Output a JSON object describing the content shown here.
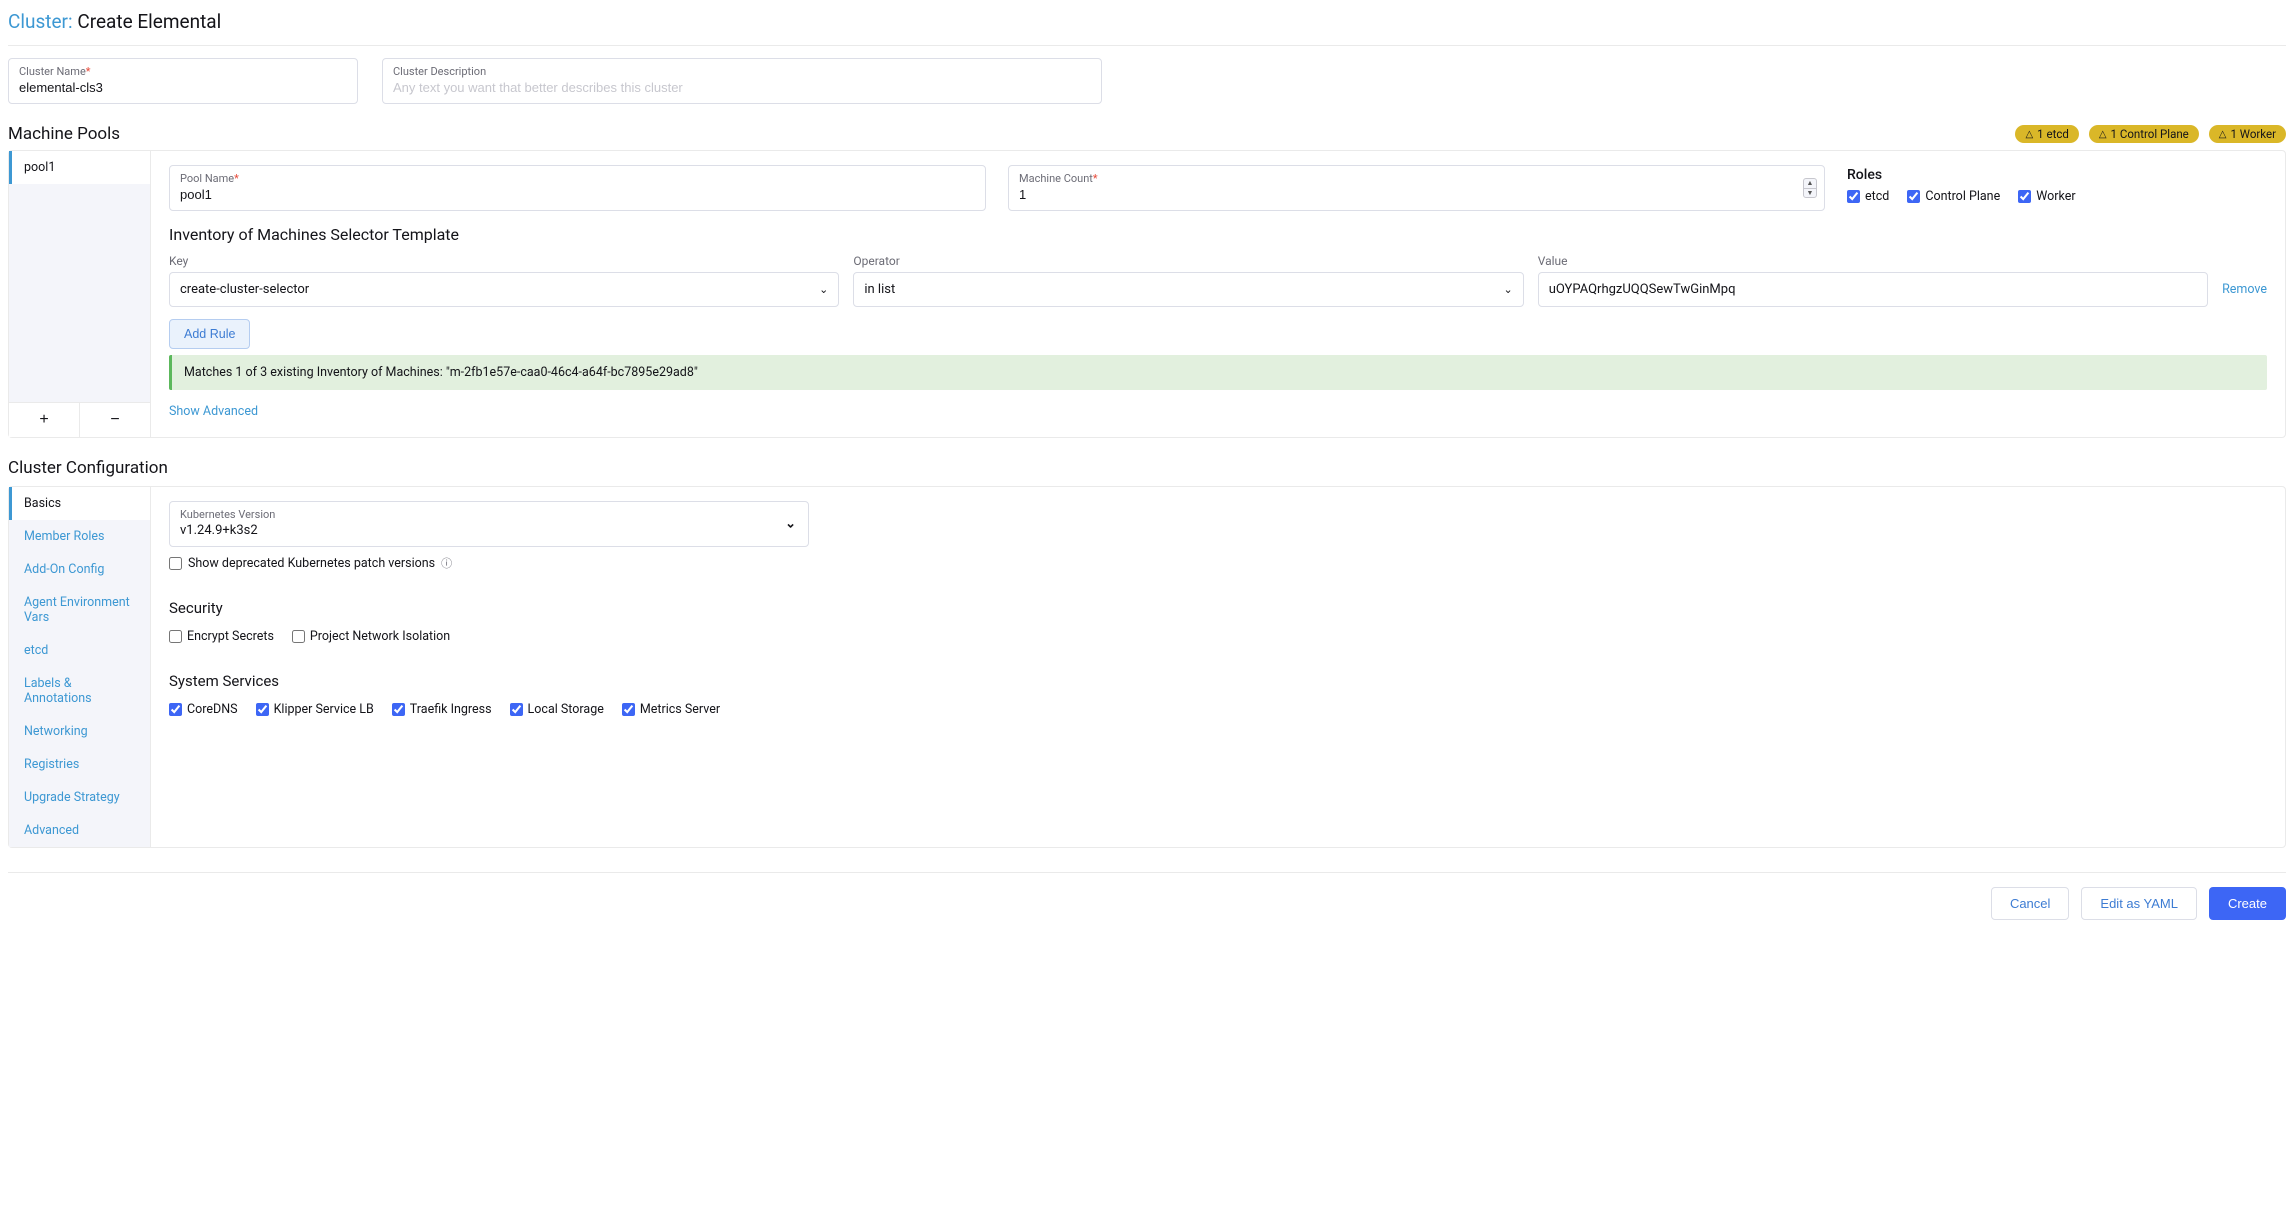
{
  "header": {
    "prefix": "Cluster:",
    "title": "Create Elemental"
  },
  "cluster": {
    "name_label": "Cluster Name",
    "name_value": "elemental-cls3",
    "desc_label": "Cluster Description",
    "desc_placeholder": "Any text you want that better describes this cluster"
  },
  "pools": {
    "section_title": "Machine Pools",
    "badges": [
      "1 etcd",
      "1 Control Plane",
      "1 Worker"
    ],
    "tabs": [
      "pool1"
    ],
    "pool_name_label": "Pool Name",
    "pool_name_value": "pool1",
    "machine_count_label": "Machine Count",
    "machine_count_value": "1",
    "roles_title": "Roles",
    "role_etcd": "etcd",
    "role_cp": "Control Plane",
    "role_worker": "Worker",
    "inventory_title": "Inventory of Machines Selector Template",
    "key_label": "Key",
    "key_value": "create-cluster-selector",
    "op_label": "Operator",
    "op_value": "in list",
    "val_label": "Value",
    "val_value": "uOYPAQrhgzUQQSewTwGinMpq",
    "remove": "Remove",
    "add_rule": "Add Rule",
    "matches": "Matches 1 of 3 existing Inventory of Machines: \"m-2fb1e57e-caa0-46c4-a64f-bc7895e29ad8\"",
    "show_advanced": "Show Advanced"
  },
  "config": {
    "section_title": "Cluster Configuration",
    "tabs": [
      "Basics",
      "Member Roles",
      "Add-On Config",
      "Agent Environment Vars",
      "etcd",
      "Labels & Annotations",
      "Networking",
      "Registries",
      "Upgrade Strategy",
      "Advanced"
    ],
    "k8s_label": "Kubernetes Version",
    "k8s_value": "v1.24.9+k3s2",
    "deprecated_label": "Show deprecated Kubernetes patch versions",
    "security_title": "Security",
    "encrypt": "Encrypt Secrets",
    "isolation": "Project Network Isolation",
    "services_title": "System Services",
    "svc_coredns": "CoreDNS",
    "svc_klipper": "Klipper Service LB",
    "svc_traefik": "Traefik Ingress",
    "svc_local": "Local Storage",
    "svc_metrics": "Metrics Server"
  },
  "footer": {
    "cancel": "Cancel",
    "yaml": "Edit as YAML",
    "create": "Create"
  }
}
